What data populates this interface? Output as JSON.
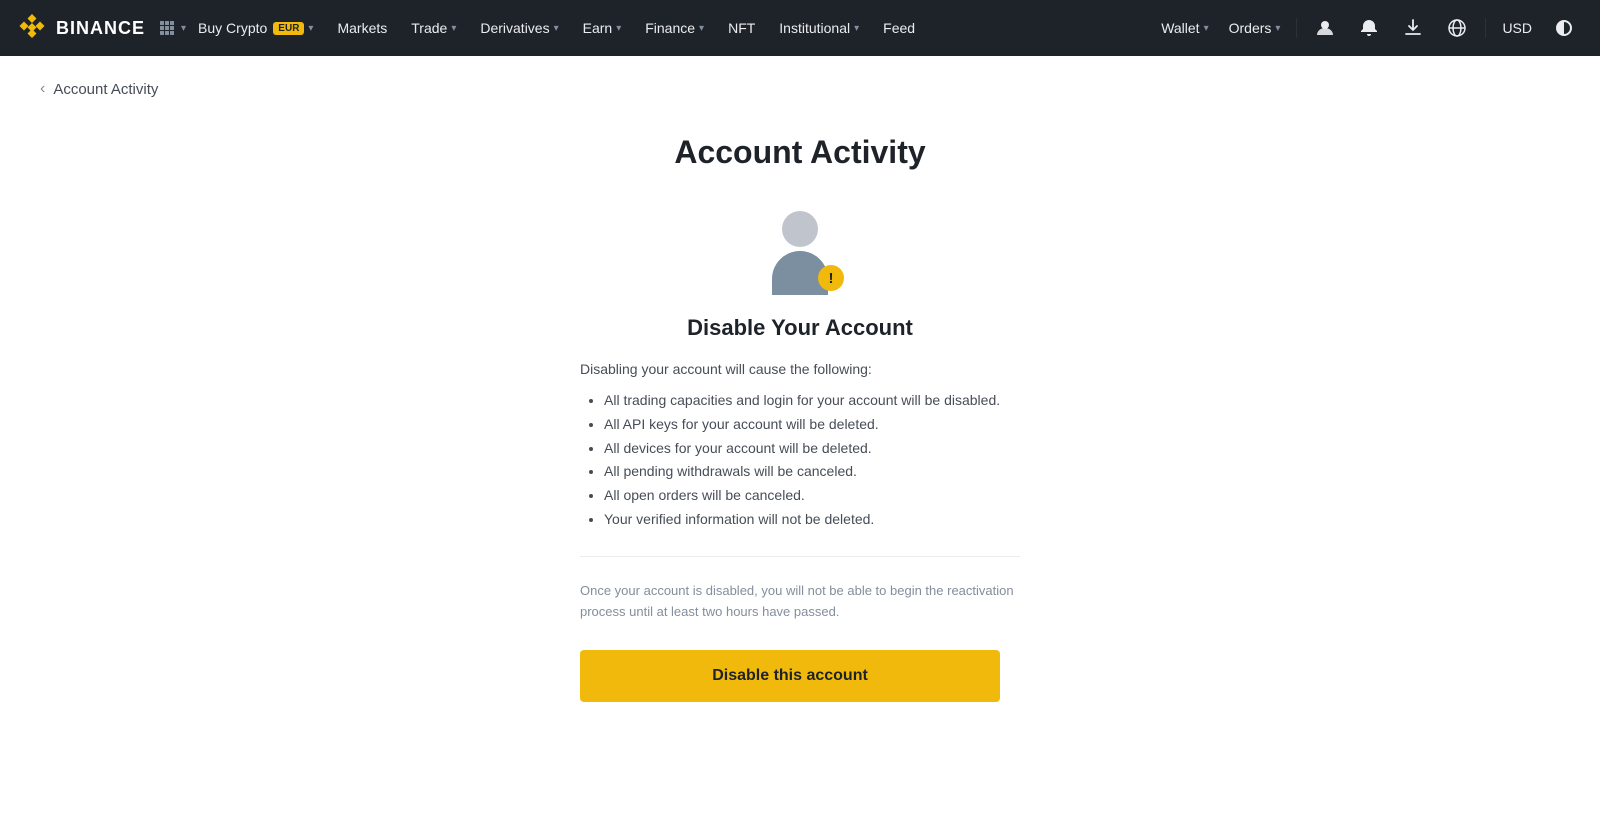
{
  "nav": {
    "logo_text": "BINANCE",
    "grid_icon": "⊞",
    "items": [
      {
        "label": "Buy Crypto",
        "badge": "EUR",
        "has_chevron": true
      },
      {
        "label": "Markets",
        "has_chevron": false
      },
      {
        "label": "Trade",
        "has_chevron": true
      },
      {
        "label": "Derivatives",
        "has_chevron": true
      },
      {
        "label": "Earn",
        "has_chevron": true
      },
      {
        "label": "Finance",
        "has_chevron": true
      },
      {
        "label": "NFT",
        "has_chevron": false
      },
      {
        "label": "Institutional",
        "has_chevron": true
      },
      {
        "label": "Feed",
        "has_chevron": false
      }
    ],
    "right_items": [
      {
        "label": "Wallet",
        "has_chevron": true
      },
      {
        "label": "Orders",
        "has_chevron": true
      }
    ],
    "currency": "USD"
  },
  "breadcrumb": {
    "back_label": "‹",
    "title": "Account Activity"
  },
  "main": {
    "page_title": "Account Activity",
    "disable_section_title": "Disable Your Account",
    "effects_intro": "Disabling your account will cause the following:",
    "effects": [
      "All trading capacities and login for your account will be disabled.",
      "All API keys for your account will be deleted.",
      "All devices for your account will be deleted.",
      "All pending withdrawals will be canceled.",
      "All open orders will be canceled.",
      "Your verified information will not be deleted."
    ],
    "note_text": "Once your account is disabled, you will not be able to begin the reactivation process until at least two hours have passed.",
    "disable_button_label": "Disable this account"
  }
}
